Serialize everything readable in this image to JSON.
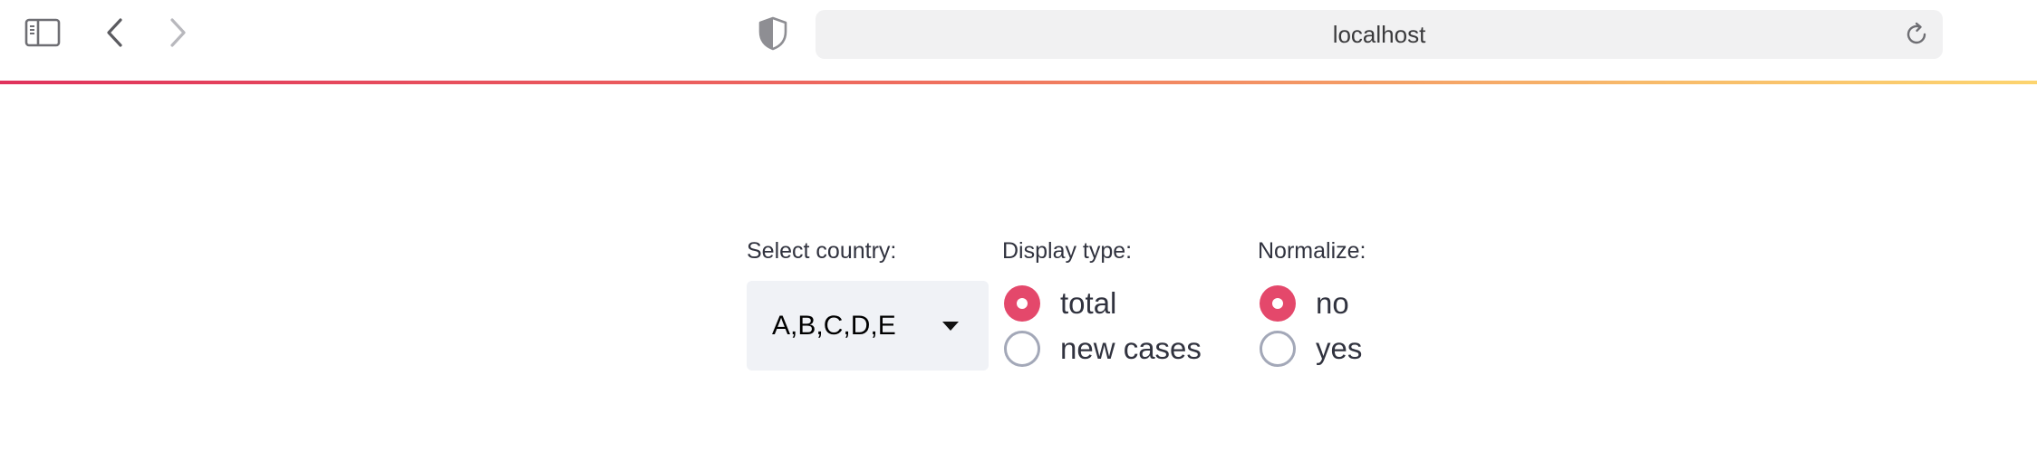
{
  "browser": {
    "url": "localhost",
    "icons": {
      "sidebar": "sidebar-toggle-icon",
      "back": "chevron-left-icon",
      "forward": "chevron-right-icon",
      "privacy": "shield-icon",
      "reload": "reload-icon"
    }
  },
  "app": {
    "accent_color": "#e4486b",
    "country_select": {
      "label": "Select country:",
      "value": "A,B,C,D,E"
    },
    "display_type": {
      "label": "Display type:",
      "options": [
        {
          "label": "total",
          "selected": true
        },
        {
          "label": "new cases",
          "selected": false
        }
      ]
    },
    "normalize": {
      "label": "Normalize:",
      "options": [
        {
          "label": "no",
          "selected": true
        },
        {
          "label": "yes",
          "selected": false
        }
      ]
    }
  }
}
